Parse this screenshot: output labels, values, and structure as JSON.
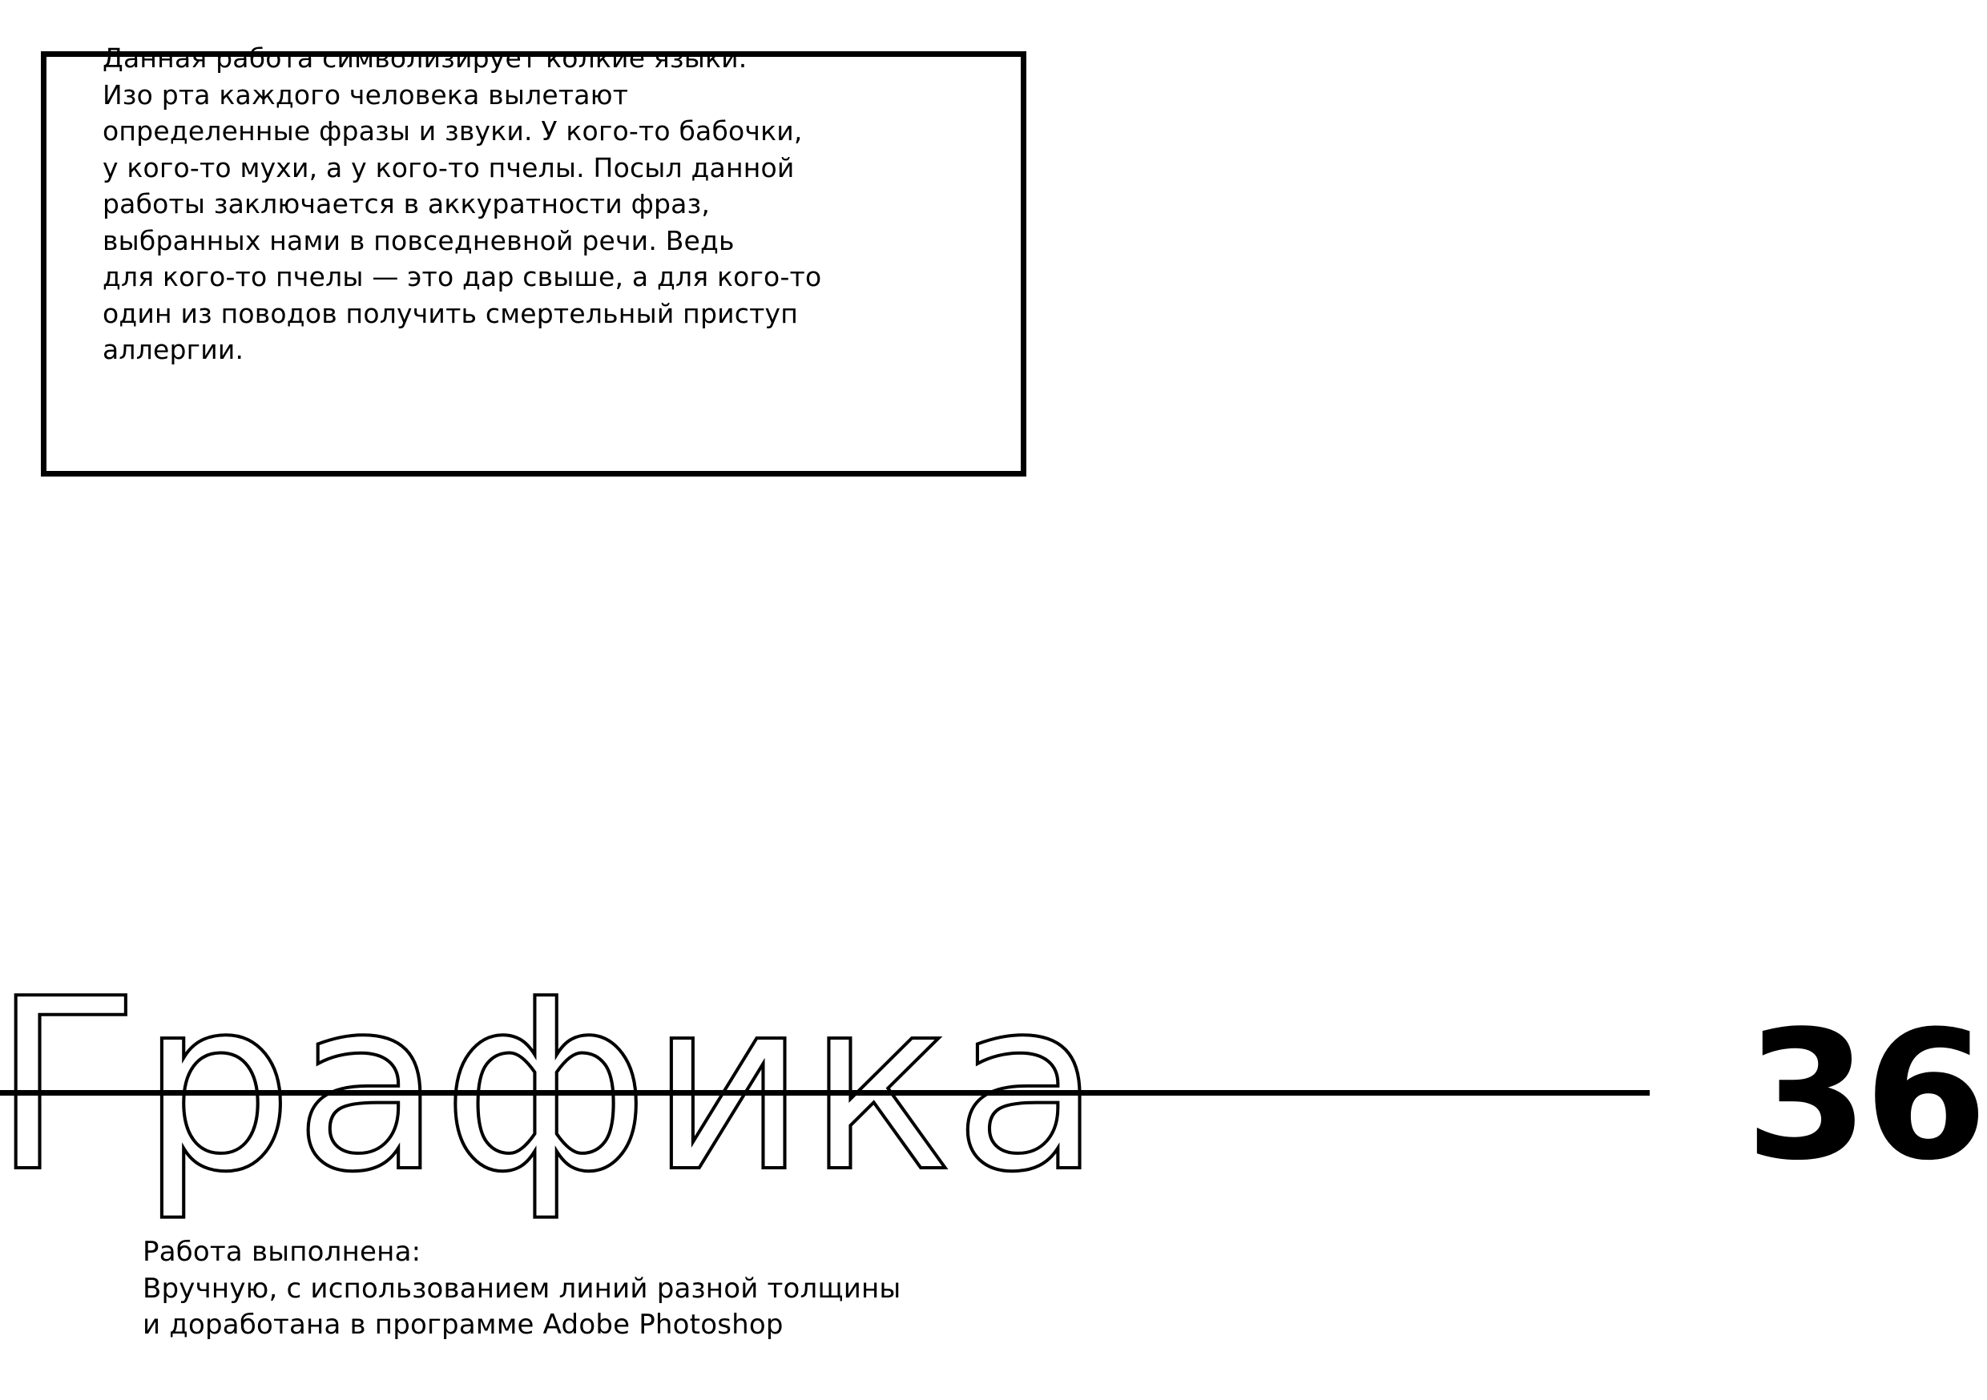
{
  "description": {
    "text": "Данная работа символизирует колкие языки.\nИзо рта каждого человека вылетают\nопределенные фразы и звуки. У кого-то бабочки,\nу кого-то мухи, а у кого-то пчелы. Посыл данной\nработы заключается в аккуратности фраз,\nвыбранных нами в повседневной речи. Ведь\nдля кого-то пчелы — это дар свыше, а для кого-то\nодин из поводов получить смертельный приступ\nаллергии."
  },
  "title": "Графика",
  "page_number": "36",
  "method": {
    "text": "Работа выполнена:\nВручную, с использованием линий разной толщины\nи доработана в программе Adobe Photoshop"
  },
  "colors": {
    "ink": "#000000",
    "background": "#ffffff"
  }
}
